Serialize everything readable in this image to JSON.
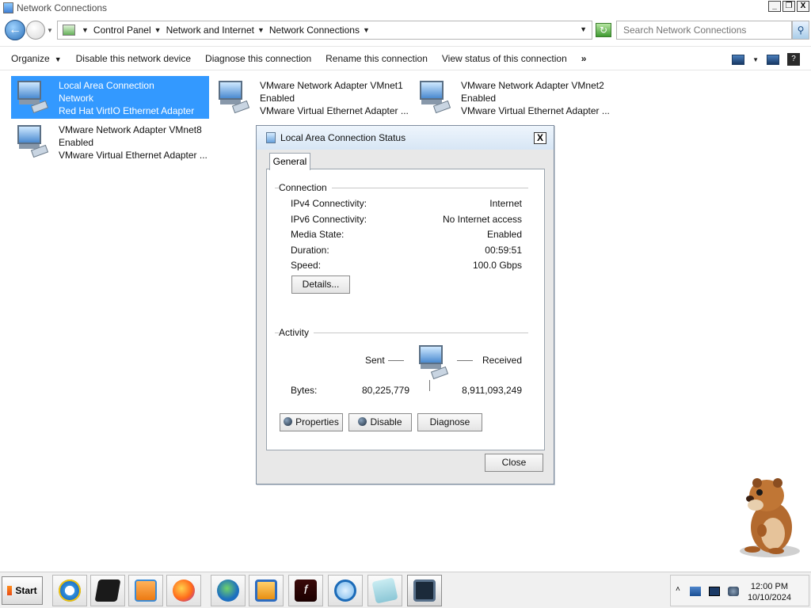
{
  "window": {
    "title": "Network Connections",
    "buttons": {
      "minimize": "_",
      "restore": "❐",
      "close": "X"
    }
  },
  "address": {
    "crumbs": [
      "Control Panel",
      "Network and Internet",
      "Network Connections"
    ],
    "search_placeholder": "Search Network Connections"
  },
  "commands": {
    "organize": "Organize",
    "disable": "Disable this network device",
    "diagnose": "Diagnose this connection",
    "rename": "Rename this connection",
    "view_status": "View status of this connection",
    "more": "»"
  },
  "connections": [
    {
      "name": "Local Area Connection",
      "status": "Network",
      "device": "Red Hat VirtIO Ethernet Adapter",
      "selected": true
    },
    {
      "name": "VMware Network Adapter VMnet1",
      "status": "Enabled",
      "device": "VMware Virtual Ethernet Adapter ...",
      "selected": false
    },
    {
      "name": "VMware Network Adapter VMnet2",
      "status": "Enabled",
      "device": "VMware Virtual Ethernet Adapter ...",
      "selected": false
    },
    {
      "name": "VMware Network Adapter VMnet8",
      "status": "Enabled",
      "device": "VMware Virtual Ethernet Adapter ...",
      "selected": false
    }
  ],
  "dialog": {
    "title": "Local Area Connection Status",
    "close": "X",
    "tab": "General",
    "connection_group": "Connection",
    "rows": [
      {
        "label": "IPv4 Connectivity:",
        "value": "Internet"
      },
      {
        "label": "IPv6 Connectivity:",
        "value": "No Internet access"
      },
      {
        "label": "Media State:",
        "value": "Enabled"
      },
      {
        "label": "Duration:",
        "value": "00:59:51"
      },
      {
        "label": "Speed:",
        "value": "100.0 Gbps"
      }
    ],
    "details_button": "Details...",
    "activity_group": "Activity",
    "sent_label": "Sent",
    "received_label": "Received",
    "bytes_label": "Bytes:",
    "bytes_sent": "80,225,779",
    "bytes_received": "8,911,093,249",
    "properties_button": "Properties",
    "disable_button": "Disable",
    "diagnose_button": "Diagnose",
    "close_button": "Close"
  },
  "taskbar": {
    "start": "Start",
    "apps": [
      "internet-explorer",
      "terminal",
      "media-player",
      "firefox",
      "network-globe",
      "virtualbox",
      "flash",
      "globe",
      "notes",
      "network-connections"
    ],
    "time": "12:00 PM",
    "date": "10/10/2024"
  },
  "colors": {
    "selection": "#3399ff",
    "dialog_bg": "#e8e8e8"
  }
}
